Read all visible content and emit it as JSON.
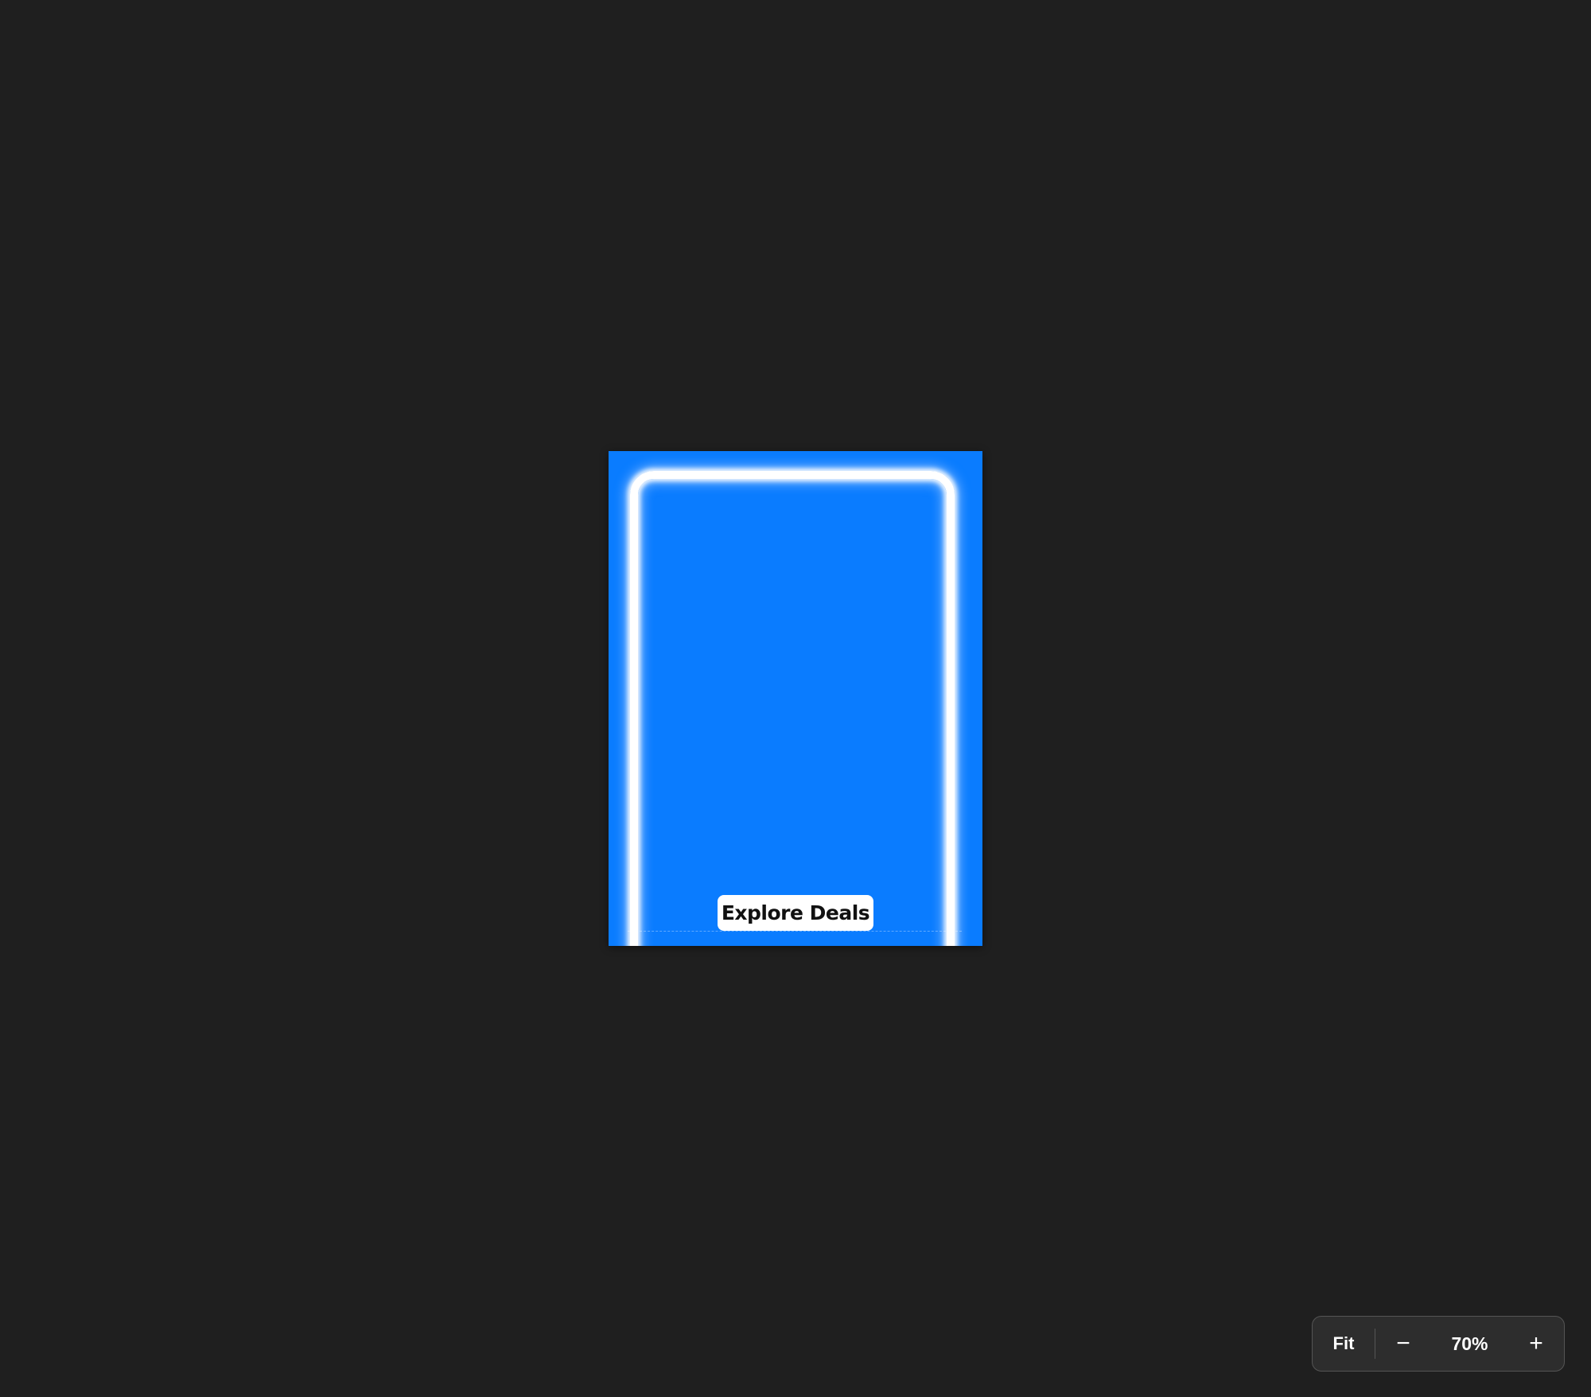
{
  "canvas": {
    "background_color": "#1f1f1f",
    "artboard": {
      "background_color": "#0a7cff",
      "frame_color": "#ffffff",
      "cta_label": "Explore Deals"
    }
  },
  "zoom_controls": {
    "fit_label": "Fit",
    "zoom_out_icon": "minus-icon",
    "zoom_out_glyph": "−",
    "zoom_level": "70%",
    "zoom_in_icon": "plus-icon",
    "zoom_in_glyph": "+"
  }
}
